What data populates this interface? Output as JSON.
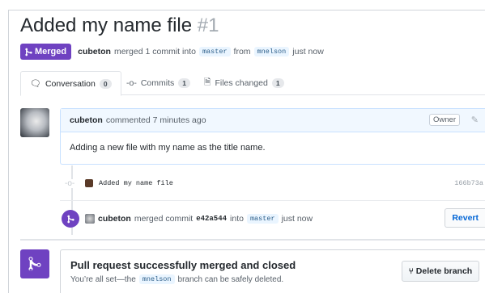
{
  "pull_request": {
    "title": "Added my name file",
    "number": "#1",
    "status_badge": "Merged",
    "author": "cubeton",
    "summary_mid": "merged 1 commit into",
    "base_branch": "master",
    "from_word": "from",
    "head_branch": "mnelson",
    "time": "just now"
  },
  "tabs": [
    {
      "label": "Conversation",
      "count": "0",
      "icon": "comment-icon"
    },
    {
      "label": "Commits",
      "count": "1",
      "icon": "commit-icon"
    },
    {
      "label": "Files changed",
      "count": "1",
      "icon": "file-diff-icon"
    }
  ],
  "comment": {
    "author": "cubeton",
    "action": "commented 7 minutes ago",
    "role_badge": "Owner",
    "body": "Adding a new file with my name as the title name."
  },
  "commit": {
    "message": "Added my name file",
    "sha": "166b73a"
  },
  "merge_event": {
    "author": "cubeton",
    "action": "merged commit",
    "sha": "e42a544",
    "into_word": "into",
    "branch": "master",
    "time": "just now",
    "revert_label": "Revert"
  },
  "merge_status": {
    "title": "Pull request successfully merged and closed",
    "sub_before": "You’re all set—the",
    "branch": "mnelson",
    "sub_after": "branch can be safely deleted.",
    "delete_label": "Delete branch"
  },
  "colors": {
    "merged_purple": "#6f42c1",
    "link_blue": "#0366d6"
  }
}
